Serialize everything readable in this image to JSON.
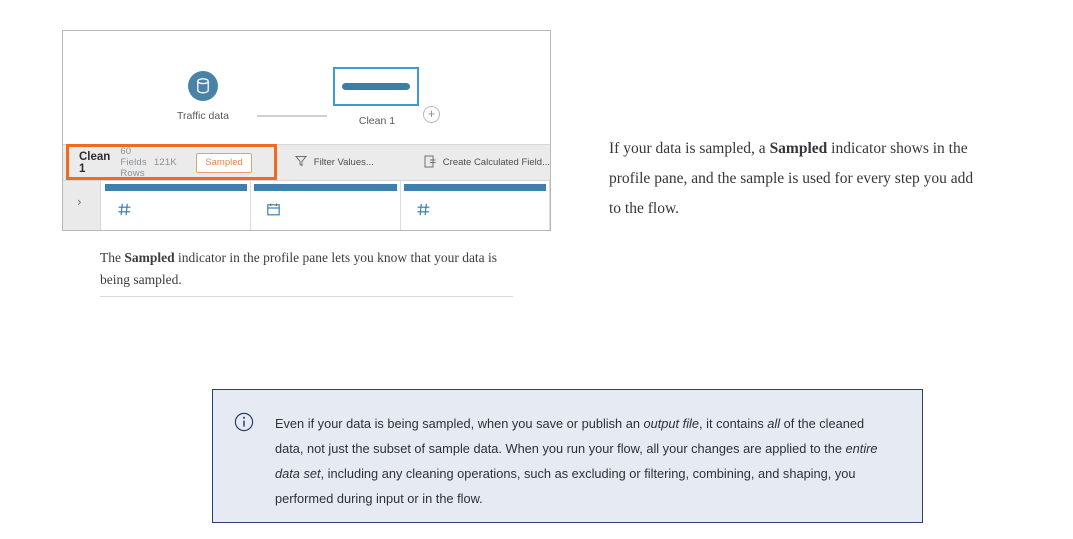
{
  "figure": {
    "flow": {
      "input_node_label": "Traffic data",
      "input_node_icon": "database-icon",
      "clean_node_label": "Clean 1",
      "add_step_icon": "plus-circle-icon"
    },
    "profile_toolbar": {
      "step_name": "Clean 1",
      "fields_count": "60 Fields",
      "rows_count": "121K Rows",
      "sampled_badge": "Sampled",
      "actions": [
        {
          "label": "Filter Values...",
          "icon": "filter-funnel-icon"
        },
        {
          "label": "Create Calculated Field...",
          "icon": "calculated-field-icon"
        }
      ],
      "highlight_color": "#f06b1e",
      "badge_color": "#dd8556"
    },
    "grid": {
      "expand_icon": "chevron-right-icon",
      "columns": [
        {
          "type_icon": "number-hash-icon"
        },
        {
          "type_icon": "date-calendar-icon"
        },
        {
          "type_icon": "number-hash-icon"
        }
      ]
    }
  },
  "caption": {
    "before": "The ",
    "bold": "Sampled",
    "after": " indicator in the profile pane lets you know that your data is being sampled."
  },
  "body_paragraph": {
    "part1": "If your data is sampled, a ",
    "bold": "Sampled",
    "part2": " indicator shows in the profile pane, and the sample is used for every step you add to the flow."
  },
  "callout": {
    "icon": "info-circle-icon",
    "accent_color": "#2b4170",
    "background_color": "#e6eaf3",
    "segments": [
      {
        "text": "Even if your data is being sampled, when you save or publish an ",
        "style": "normal"
      },
      {
        "text": "output file",
        "style": "italic"
      },
      {
        "text": ", it contains ",
        "style": "normal"
      },
      {
        "text": "all",
        "style": "italic"
      },
      {
        "text": " of the cleaned data, not just the subset of sample data. When you run your flow, all your changes are applied to the ",
        "style": "normal"
      },
      {
        "text": "entire data set",
        "style": "italic"
      },
      {
        "text": ", including any cleaning operations, such as excluding or filtering, combining, and shaping, you performed during input or in the flow.",
        "style": "normal"
      }
    ]
  }
}
